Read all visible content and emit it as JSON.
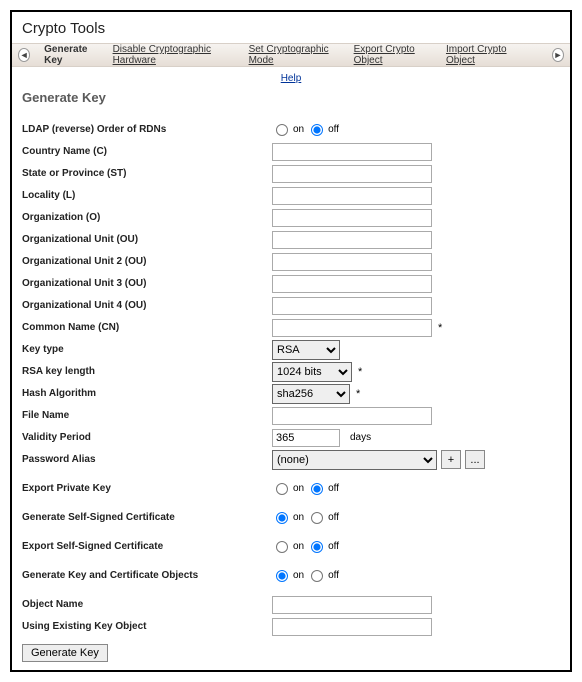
{
  "title": "Crypto Tools",
  "tabs": {
    "back_icon": "◄",
    "forward_icon": "►",
    "items": [
      "Generate Key",
      "Disable Cryptographic Hardware",
      "Set Cryptographic Mode",
      "Export Crypto Object",
      "Import Crypto Object"
    ]
  },
  "help_label": "Help",
  "section_heading": "Generate Key",
  "labels": {
    "ldap": "LDAP (reverse) Order of RDNs",
    "country": "Country Name (C)",
    "state": "State or Province (ST)",
    "locality": "Locality (L)",
    "org": "Organization (O)",
    "ou1": "Organizational Unit (OU)",
    "ou2": "Organizational Unit 2 (OU)",
    "ou3": "Organizational Unit 3 (OU)",
    "ou4": "Organizational Unit 4 (OU)",
    "cn": "Common Name (CN)",
    "keytype": "Key type",
    "keylen": "RSA key length",
    "hash": "Hash Algorithm",
    "filename": "File Name",
    "validity": "Validity Period",
    "pwdalias": "Password Alias",
    "exportpk": "Export Private Key",
    "gensscert": "Generate Self-Signed Certificate",
    "exportsscert": "Export Self-Signed Certificate",
    "genkeycert": "Generate Key and Certificate Objects",
    "objname": "Object Name",
    "useexisting": "Using Existing Key Object"
  },
  "values": {
    "keytype": "RSA",
    "keylen": "1024 bits",
    "hash": "sha256",
    "validity": "365",
    "pwdalias": "(none)",
    "country": "",
    "state": "",
    "locality": "",
    "org": "",
    "ou1": "",
    "ou2": "",
    "ou3": "",
    "ou4": "",
    "cn": "",
    "filename": "",
    "objname": "",
    "useexisting": ""
  },
  "radio": {
    "on": "on",
    "off": "off"
  },
  "suffix": {
    "days": "days",
    "ast": "*"
  },
  "btn": {
    "plus": "+",
    "dots": "...",
    "generate": "Generate Key"
  }
}
